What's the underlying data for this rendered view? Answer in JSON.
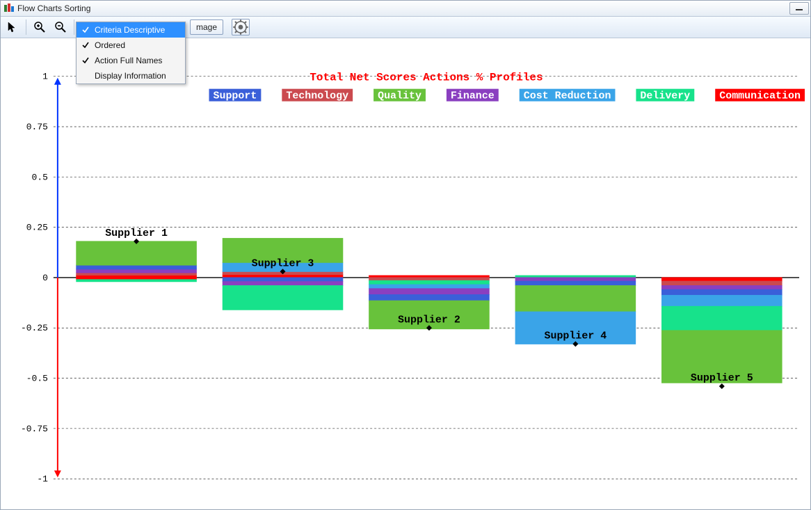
{
  "window": {
    "title": "Flow Charts Sorting"
  },
  "toolbar": {
    "mage_partial_label": "mage"
  },
  "menu": {
    "items": [
      {
        "label": "Criteria Descriptive",
        "checked": true,
        "selected": true
      },
      {
        "label": "Ordered",
        "checked": true,
        "selected": false
      },
      {
        "label": "Action Full Names",
        "checked": true,
        "selected": false
      },
      {
        "label": "Display Information",
        "checked": false,
        "selected": false
      }
    ]
  },
  "chart_data": {
    "type": "bar",
    "title": "Total Net Scores Actions % Profiles",
    "ylabel": "",
    "ylim": [
      -1,
      1
    ],
    "yticks": [
      -1,
      -0.75,
      -0.5,
      -0.25,
      0,
      0.25,
      0.5,
      0.75,
      1
    ],
    "criteria": [
      {
        "name": "Support",
        "color": "#3a5fd9"
      },
      {
        "name": "Technology",
        "color": "#cb4a4f"
      },
      {
        "name": "Quality",
        "color": "#68c23b"
      },
      {
        "name": "Finance",
        "color": "#8a3fc0"
      },
      {
        "name": "Cost Reduction",
        "color": "#3aa4e8"
      },
      {
        "name": "Delivery",
        "color": "#17e28b"
      },
      {
        "name": "Communication",
        "color": "#ff0000"
      }
    ],
    "suppliers": [
      {
        "name": "Supplier 1",
        "offset_index": 0,
        "diamond_pos": 0.18,
        "pos_segments": [
          {
            "criterion": "Communication",
            "value": 0.012
          },
          {
            "criterion": "Technology",
            "value": 0.012
          },
          {
            "criterion": "Finance",
            "value": 0.018
          },
          {
            "criterion": "Support",
            "value": 0.02
          },
          {
            "criterion": "Quality",
            "value": 0.118
          }
        ],
        "neg_segments": [
          {
            "criterion": "Communication",
            "value": 0.01
          },
          {
            "criterion": "Delivery",
            "value": 0.01
          }
        ]
      },
      {
        "name": "Supplier 3",
        "offset_index": 1,
        "diamond_pos": 0.03,
        "pos_segments": [
          {
            "criterion": "Communication",
            "value": 0.015
          },
          {
            "criterion": "Technology",
            "value": 0.015
          },
          {
            "criterion": "Cost Reduction",
            "value": 0.045
          },
          {
            "criterion": "Quality",
            "value": 0.12
          }
        ],
        "neg_segments": [
          {
            "criterion": "Support",
            "value": 0.02
          },
          {
            "criterion": "Finance",
            "value": 0.02
          },
          {
            "criterion": "Delivery",
            "value": 0.12
          }
        ]
      },
      {
        "name": "Supplier 2",
        "offset_index": 2,
        "diamond_pos": -0.25,
        "pos_segments": [
          {
            "criterion": "Communication",
            "value": 0.01
          }
        ],
        "neg_segments": [
          {
            "criterion": "Technology",
            "value": 0.015
          },
          {
            "criterion": "Delivery",
            "value": 0.02
          },
          {
            "criterion": "Cost Reduction",
            "value": 0.02
          },
          {
            "criterion": "Finance",
            "value": 0.03
          },
          {
            "criterion": "Support",
            "value": 0.03
          },
          {
            "criterion": "Quality",
            "value": 0.14
          }
        ]
      },
      {
        "name": "Supplier 4",
        "offset_index": 3,
        "diamond_pos": -0.33,
        "pos_segments": [
          {
            "criterion": "Delivery",
            "value": 0.01
          }
        ],
        "neg_segments": [
          {
            "criterion": "Finance",
            "value": 0.018
          },
          {
            "criterion": "Support",
            "value": 0.022
          },
          {
            "criterion": "Quality",
            "value": 0.13
          },
          {
            "criterion": "Cost Reduction",
            "value": 0.16
          }
        ]
      },
      {
        "name": "Supplier 5",
        "offset_index": 4,
        "diamond_pos": -0.54,
        "pos_segments": [],
        "neg_segments": [
          {
            "criterion": "Communication",
            "value": 0.018
          },
          {
            "criterion": "Technology",
            "value": 0.022
          },
          {
            "criterion": "Finance",
            "value": 0.02
          },
          {
            "criterion": "Support",
            "value": 0.028
          },
          {
            "criterion": "Cost Reduction",
            "value": 0.055
          },
          {
            "criterion": "Delivery",
            "value": 0.12
          },
          {
            "criterion": "Quality",
            "value": 0.26
          }
        ]
      }
    ]
  }
}
